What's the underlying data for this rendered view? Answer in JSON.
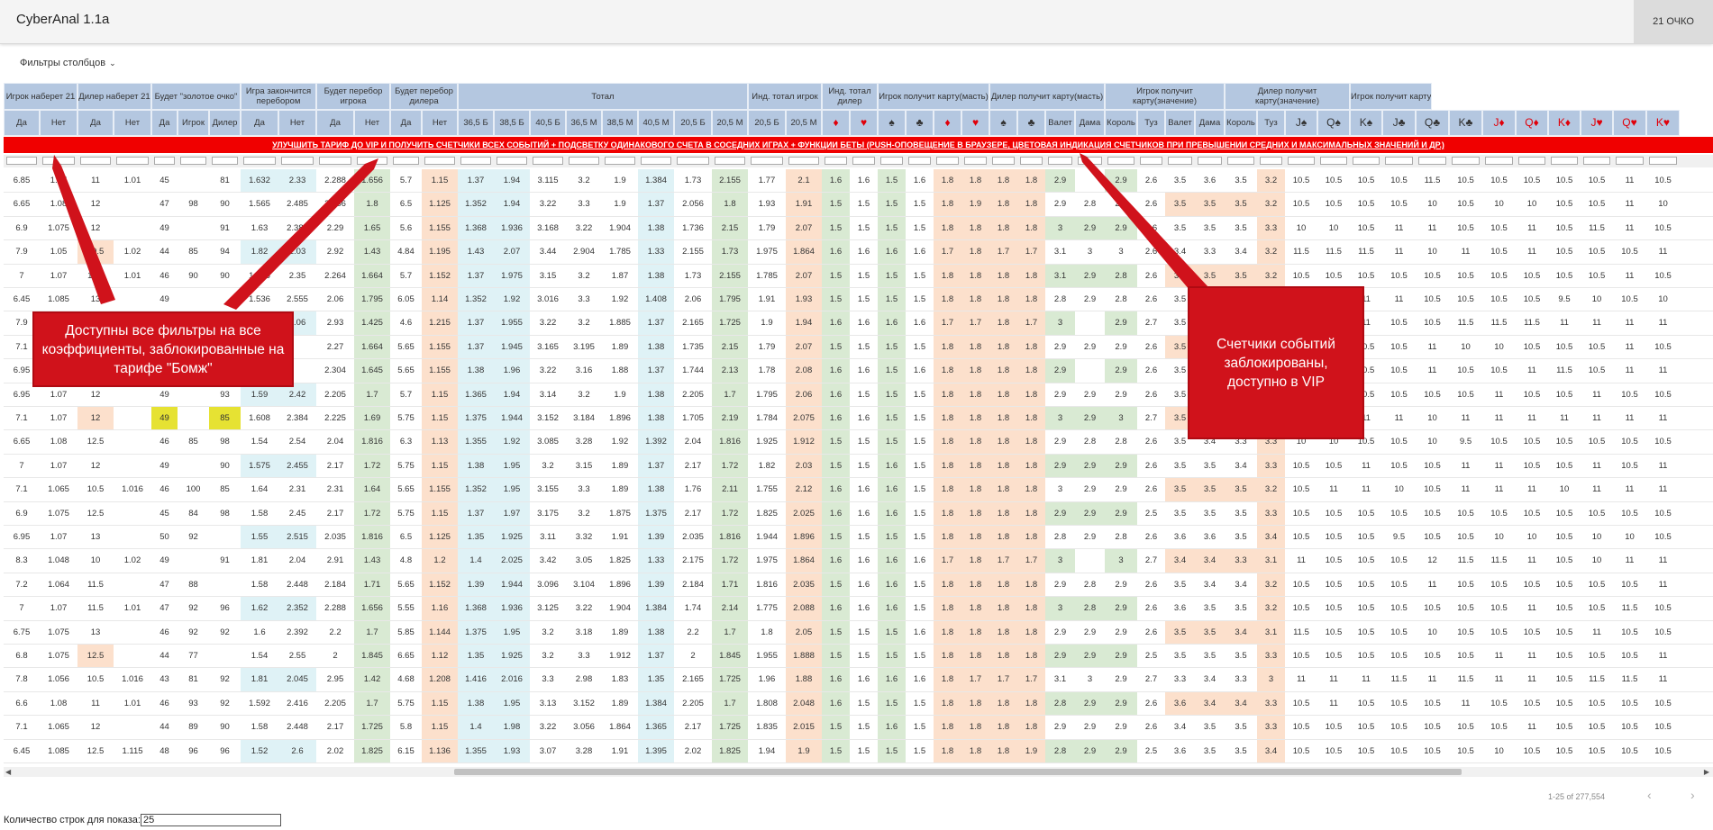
{
  "app": {
    "title": "CyberAnal 1.1a",
    "score": "21 ОЧКО"
  },
  "filters_label": "Фильтры столбцов",
  "header_groups": [
    {
      "label": "Игрок наберет 21",
      "cols": 2
    },
    {
      "label": "Дилер наберет 21",
      "cols": 2
    },
    {
      "label": "Будет \"золотое очко\"",
      "cols": 3
    },
    {
      "label": "Игра закончится перебором",
      "cols": 2
    },
    {
      "label": "Будет перебор игрока",
      "cols": 2
    },
    {
      "label": "Будет перебор дилера",
      "cols": 2
    },
    {
      "label": "Тотал",
      "cols": 8
    },
    {
      "label": "Инд. тотал игрок",
      "cols": 2
    },
    {
      "label": "Инд. тотал дилер",
      "cols": 2
    },
    {
      "label": "Игрок получит карту(масть)",
      "cols": 4
    },
    {
      "label": "Дилер получит карту(масть)",
      "cols": 4
    },
    {
      "label": "Игрок получит карту(значение)",
      "cols": 4
    },
    {
      "label": "Дилер получит карту(значение)",
      "cols": 4
    },
    {
      "label": "Игрок получит карту",
      "cols": 12
    }
  ],
  "sub_headers": [
    "Да",
    "Нет",
    "Да",
    "Нет",
    "Да",
    "Игрок",
    "Дилер",
    "Да",
    "Нет",
    "Да",
    "Нет",
    "Да",
    "Нет",
    "36,5 Б",
    "38,5 Б",
    "40,5 Б",
    "36,5 М",
    "38,5 М",
    "40,5 М",
    "20,5 Б",
    "20,5 М",
    "20,5 Б",
    "20,5 М",
    "♦",
    "♥",
    "♠",
    "♣",
    "♦",
    "♥",
    "♠",
    "♣",
    "Валет",
    "Дама",
    "Король",
    "Туз",
    "Валет",
    "Дама",
    "Король",
    "Туз",
    "J♠",
    "Q♠",
    "K♠",
    "J♣",
    "Q♣",
    "K♣",
    "J♦",
    "Q♦",
    "K♦",
    "J♥",
    "Q♥",
    "K♥"
  ],
  "banner": "УЛУЧШИТЬ ТАРИФ ДО VIP И ПОЛУЧИТЬ СЧЕТЧИКИ ВСЕХ СОБЫТИЙ + ПОДСВЕТКУ ОДИНАКОВОГО СЧЕТА В СОСЕДНИХ ИГРАХ + ФУНКЦИИ БЕТЫ (PUSH-ОПОВЕЩЕНИЕ В БРАУЗЕРЕ, ЦВЕТОВАЯ ИНДИКАЦИЯ СЧЕТЧИКОВ ПРИ ПРЕВЫШЕНИИ СРЕДНИХ И МАКСИМАЛЬНЫХ ЗНАЧЕНИЙ И ДР.)",
  "rows": [
    [
      "6.85",
      "1.07",
      "11",
      "1.01",
      "45",
      "",
      "81",
      "1.632",
      "2.33",
      "2.288",
      "1.656",
      "5.7",
      "1.15",
      "1.37",
      "1.94",
      "3.115",
      "3.2",
      "1.9",
      "1.384",
      "1.73",
      "2.155",
      "1.77",
      "2.1",
      "1.6",
      "1.6",
      "1.5",
      "1.6",
      "1.8",
      "1.8",
      "1.8",
      "1.8",
      "2.9",
      "",
      "2.9",
      "2.6",
      "3.5",
      "3.6",
      "3.5",
      "3.2",
      "10.5",
      "10.5",
      "10.5",
      "10.5",
      "11.5",
      "10.5",
      "10.5",
      "10.5",
      "10.5",
      "10.5",
      "11",
      "10.5"
    ],
    [
      "6.65",
      "1.08",
      "12",
      "",
      "47",
      "98",
      "90",
      "1.565",
      "2.485",
      "2.056",
      "1.8",
      "6.5",
      "1.125",
      "1.352",
      "1.94",
      "3.22",
      "3.3",
      "1.9",
      "1.37",
      "2.056",
      "1.8",
      "1.93",
      "1.91",
      "1.5",
      "1.5",
      "1.5",
      "1.5",
      "1.8",
      "1.9",
      "1.8",
      "1.8",
      "2.9",
      "2.8",
      "2.9",
      "2.6",
      "3.5",
      "3.5",
      "3.5",
      "3.2",
      "10.5",
      "10.5",
      "10.5",
      "10.5",
      "10",
      "10.5",
      "10",
      "10",
      "10.5",
      "10.5",
      "11",
      "10"
    ],
    [
      "6.9",
      "1.075",
      "12",
      "",
      "49",
      "",
      "91",
      "1.63",
      "2.385",
      "2.29",
      "1.65",
      "5.6",
      "1.155",
      "1.368",
      "1.936",
      "3.168",
      "3.22",
      "1.904",
      "1.38",
      "1.736",
      "2.15",
      "1.79",
      "2.07",
      "1.5",
      "1.5",
      "1.5",
      "1.5",
      "1.8",
      "1.8",
      "1.8",
      "1.8",
      "3",
      "2.9",
      "2.9",
      "2.6",
      "3.5",
      "3.5",
      "3.5",
      "3.3",
      "10",
      "10",
      "10.5",
      "11",
      "11",
      "10.5",
      "10.5",
      "11",
      "10.5",
      "11.5",
      "11",
      "10.5"
    ],
    [
      "7.9",
      "1.05",
      "10.5",
      "1.02",
      "44",
      "85",
      "94",
      "1.82",
      "2.03",
      "2.92",
      "1.43",
      "4.84",
      "1.195",
      "1.43",
      "2.07",
      "3.44",
      "2.904",
      "1.785",
      "1.33",
      "2.155",
      "1.73",
      "1.975",
      "1.864",
      "1.6",
      "1.6",
      "1.6",
      "1.6",
      "1.7",
      "1.8",
      "1.7",
      "1.7",
      "3.1",
      "3",
      "3",
      "2.6",
      "3.4",
      "3.3",
      "3.4",
      "3.2",
      "11.5",
      "11.5",
      "11.5",
      "11",
      "10",
      "11",
      "10.5",
      "11",
      "10.5",
      "10.5",
      "10.5",
      "11"
    ],
    [
      "7",
      "1.07",
      "11.5",
      "1.01",
      "46",
      "90",
      "90",
      "1.625",
      "2.35",
      "2.264",
      "1.664",
      "5.7",
      "1.152",
      "1.37",
      "1.975",
      "3.15",
      "3.2",
      "1.87",
      "1.38",
      "1.73",
      "2.155",
      "1.785",
      "2.07",
      "1.5",
      "1.5",
      "1.5",
      "1.5",
      "1.8",
      "1.8",
      "1.8",
      "1.8",
      "3.1",
      "2.9",
      "2.8",
      "2.6",
      "3.5",
      "3.5",
      "3.5",
      "3.2",
      "10.5",
      "10.5",
      "10.5",
      "10.5",
      "10.5",
      "10.5",
      "10.5",
      "10.5",
      "10.5",
      "10.5",
      "11",
      "10.5"
    ],
    [
      "6.45",
      "1.085",
      "13",
      "",
      "49",
      "",
      "",
      "1.536",
      "2.555",
      "2.06",
      "1.795",
      "6.05",
      "1.14",
      "1.352",
      "1.92",
      "3.016",
      "3.3",
      "1.92",
      "1.408",
      "2.06",
      "1.795",
      "1.91",
      "1.93",
      "1.5",
      "1.5",
      "1.5",
      "1.5",
      "1.8",
      "1.8",
      "1.8",
      "1.8",
      "2.8",
      "2.9",
      "2.8",
      "2.6",
      "3.5",
      "3.5",
      "3.5",
      "3.3",
      "10.5",
      "10.5",
      "11",
      "11",
      "10.5",
      "10.5",
      "10.5",
      "10.5",
      "9.5",
      "10",
      "10.5",
      "10"
    ],
    [
      "7.9",
      "1.05",
      "",
      "",
      "",
      "",
      "",
      "1.8",
      "2.06",
      "2.93",
      "1.425",
      "4.6",
      "1.215",
      "1.37",
      "1.955",
      "3.22",
      "3.2",
      "1.885",
      "1.37",
      "2.165",
      "1.725",
      "1.9",
      "1.94",
      "1.6",
      "1.6",
      "1.6",
      "1.6",
      "1.7",
      "1.7",
      "1.8",
      "1.7",
      "3",
      "",
      "2.9",
      "2.7",
      "3.5",
      "3.5",
      "3.5",
      "3.2",
      "10.5",
      "10.5",
      "11",
      "10.5",
      "10.5",
      "11.5",
      "11.5",
      "11.5",
      "11",
      "11",
      "11",
      "11"
    ],
    [
      "7.1",
      "",
      "",
      "",
      "",
      "",
      "",
      "",
      "",
      "2.27",
      "1.664",
      "5.65",
      "1.155",
      "1.37",
      "1.945",
      "3.165",
      "3.195",
      "1.89",
      "1.38",
      "1.735",
      "2.15",
      "1.79",
      "2.07",
      "1.5",
      "1.5",
      "1.5",
      "1.5",
      "1.8",
      "1.8",
      "1.8",
      "1.8",
      "2.9",
      "2.9",
      "2.9",
      "2.6",
      "3.5",
      "3.5",
      "3.5",
      "3.3",
      "10.5",
      "10.5",
      "10.5",
      "10.5",
      "11",
      "10",
      "10",
      "10.5",
      "10.5",
      "10.5",
      "11",
      "10.5"
    ],
    [
      "6.95",
      "",
      "",
      "",
      "",
      "",
      "",
      "",
      "",
      "2.304",
      "1.645",
      "5.65",
      "1.155",
      "1.38",
      "1.96",
      "3.22",
      "3.16",
      "1.88",
      "1.37",
      "1.744",
      "2.13",
      "1.78",
      "2.08",
      "1.6",
      "1.6",
      "1.5",
      "1.6",
      "1.8",
      "1.8",
      "1.8",
      "1.8",
      "2.9",
      "",
      "2.9",
      "2.6",
      "3.5",
      "3.5",
      "3.5",
      "3.3",
      "11",
      "10.5",
      "10.5",
      "10.5",
      "11",
      "10.5",
      "10.5",
      "11",
      "11.5",
      "10.5",
      "11",
      "11"
    ],
    [
      "6.95",
      "1.07",
      "12",
      "",
      "49",
      "",
      "93",
      "1.59",
      "2.42",
      "2.205",
      "1.7",
      "5.7",
      "1.15",
      "1.365",
      "1.94",
      "3.14",
      "3.2",
      "1.9",
      "1.38",
      "2.205",
      "1.7",
      "1.795",
      "2.06",
      "1.6",
      "1.5",
      "1.5",
      "1.5",
      "1.8",
      "1.8",
      "1.8",
      "1.8",
      "2.9",
      "2.9",
      "2.9",
      "2.6",
      "3.5",
      "3.5",
      "3.5",
      "3.3",
      "10.5",
      "11",
      "10.5",
      "10.5",
      "10.5",
      "10.5",
      "11",
      "10.5",
      "10.5",
      "11",
      "10.5",
      "10.5"
    ],
    [
      "7.1",
      "1.07",
      "12",
      "",
      "49",
      "",
      "85",
      "1.608",
      "2.384",
      "2.225",
      "1.69",
      "5.75",
      "1.15",
      "1.375",
      "1.944",
      "3.152",
      "3.184",
      "1.896",
      "1.38",
      "1.705",
      "2.19",
      "1.784",
      "2.075",
      "1.6",
      "1.6",
      "1.5",
      "1.5",
      "1.8",
      "1.8",
      "1.8",
      "1.8",
      "3",
      "2.9",
      "3",
      "2.7",
      "3.5",
      "3.5",
      "3.4",
      "3.3",
      "11",
      "11",
      "11",
      "11",
      "10",
      "11",
      "11",
      "11",
      "11",
      "11",
      "11",
      "11"
    ],
    [
      "6.65",
      "1.08",
      "12.5",
      "",
      "46",
      "85",
      "98",
      "1.54",
      "2.54",
      "2.04",
      "1.816",
      "6.3",
      "1.13",
      "1.355",
      "1.92",
      "3.085",
      "3.28",
      "1.92",
      "1.392",
      "2.04",
      "1.816",
      "1.925",
      "1.912",
      "1.5",
      "1.5",
      "1.5",
      "1.5",
      "1.8",
      "1.8",
      "1.8",
      "1.8",
      "2.9",
      "2.8",
      "2.8",
      "2.6",
      "3.5",
      "3.4",
      "3.3",
      "3.3",
      "10",
      "10",
      "10.5",
      "10.5",
      "10",
      "9.5",
      "10.5",
      "10.5",
      "10.5",
      "10.5",
      "10.5",
      "10.5"
    ],
    [
      "7",
      "1.07",
      "12",
      "",
      "49",
      "",
      "90",
      "1.575",
      "2.455",
      "2.17",
      "1.72",
      "5.75",
      "1.15",
      "1.38",
      "1.95",
      "3.2",
      "3.15",
      "1.89",
      "1.37",
      "2.17",
      "1.72",
      "1.82",
      "2.03",
      "1.5",
      "1.5",
      "1.6",
      "1.5",
      "1.8",
      "1.8",
      "1.8",
      "1.8",
      "2.9",
      "2.9",
      "2.9",
      "2.6",
      "3.5",
      "3.5",
      "3.4",
      "3.3",
      "10.5",
      "10.5",
      "11",
      "10.5",
      "10.5",
      "11",
      "11",
      "10.5",
      "10.5",
      "11",
      "10.5",
      "11"
    ],
    [
      "7.1",
      "1.065",
      "10.5",
      "1.016",
      "46",
      "100",
      "85",
      "1.64",
      "2.31",
      "2.31",
      "1.64",
      "5.65",
      "1.155",
      "1.352",
      "1.95",
      "3.155",
      "3.3",
      "1.89",
      "1.38",
      "1.76",
      "2.11",
      "1.755",
      "2.12",
      "1.6",
      "1.6",
      "1.6",
      "1.5",
      "1.8",
      "1.8",
      "1.8",
      "1.8",
      "3",
      "2.9",
      "2.9",
      "2.6",
      "3.5",
      "3.5",
      "3.5",
      "3.2",
      "10.5",
      "11",
      "11",
      "10",
      "10.5",
      "11",
      "11",
      "11",
      "10",
      "11",
      "11",
      "11"
    ],
    [
      "6.9",
      "1.075",
      "12.5",
      "",
      "45",
      "84",
      "98",
      "1.58",
      "2.45",
      "2.17",
      "1.72",
      "5.75",
      "1.15",
      "1.37",
      "1.97",
      "3.175",
      "3.2",
      "1.875",
      "1.375",
      "2.17",
      "1.72",
      "1.825",
      "2.025",
      "1.6",
      "1.6",
      "1.6",
      "1.5",
      "1.8",
      "1.8",
      "1.8",
      "1.8",
      "2.9",
      "2.9",
      "2.9",
      "2.5",
      "3.5",
      "3.5",
      "3.5",
      "3.3",
      "10.5",
      "10.5",
      "10.5",
      "10.5",
      "10.5",
      "10.5",
      "10.5",
      "10.5",
      "10.5",
      "10.5",
      "10.5",
      "10.5"
    ],
    [
      "6.95",
      "1.07",
      "13",
      "",
      "50",
      "92",
      "",
      "1.55",
      "2.515",
      "2.035",
      "1.816",
      "6.5",
      "1.125",
      "1.35",
      "1.925",
      "3.11",
      "3.32",
      "1.91",
      "1.39",
      "2.035",
      "1.816",
      "1.944",
      "1.896",
      "1.5",
      "1.5",
      "1.5",
      "1.5",
      "1.8",
      "1.8",
      "1.8",
      "1.8",
      "2.8",
      "2.9",
      "2.8",
      "2.6",
      "3.6",
      "3.6",
      "3.5",
      "3.4",
      "10.5",
      "10.5",
      "10.5",
      "9.5",
      "10.5",
      "10.5",
      "10",
      "10",
      "10.5",
      "10",
      "10",
      "10.5"
    ],
    [
      "8.3",
      "1.048",
      "10",
      "1.02",
      "49",
      "",
      "91",
      "1.81",
      "2.04",
      "2.91",
      "1.43",
      "4.8",
      "1.2",
      "1.4",
      "2.025",
      "3.42",
      "3.05",
      "1.825",
      "1.33",
      "2.175",
      "1.72",
      "1.975",
      "1.864",
      "1.6",
      "1.6",
      "1.6",
      "1.6",
      "1.7",
      "1.8",
      "1.7",
      "1.7",
      "3",
      "",
      "3",
      "2.7",
      "3.4",
      "3.4",
      "3.3",
      "3.1",
      "11",
      "10.5",
      "10.5",
      "10.5",
      "12",
      "11.5",
      "11.5",
      "11",
      "10.5",
      "10",
      "11",
      "11"
    ],
    [
      "7.2",
      "1.064",
      "11.5",
      "",
      "47",
      "88",
      "",
      "1.58",
      "2.448",
      "2.184",
      "1.71",
      "5.65",
      "1.152",
      "1.39",
      "1.944",
      "3.096",
      "3.104",
      "1.896",
      "1.39",
      "2.184",
      "1.71",
      "1.816",
      "2.035",
      "1.5",
      "1.6",
      "1.6",
      "1.5",
      "1.8",
      "1.8",
      "1.8",
      "1.8",
      "2.9",
      "2.8",
      "2.9",
      "2.6",
      "3.5",
      "3.4",
      "3.4",
      "3.2",
      "10.5",
      "10.5",
      "10.5",
      "10.5",
      "11",
      "10.5",
      "10.5",
      "10.5",
      "10.5",
      "10.5",
      "10.5",
      "11"
    ],
    [
      "7",
      "1.07",
      "11.5",
      "1.01",
      "47",
      "92",
      "96",
      "1.62",
      "2.352",
      "2.288",
      "1.656",
      "5.55",
      "1.16",
      "1.368",
      "1.936",
      "3.125",
      "3.22",
      "1.904",
      "1.384",
      "1.74",
      "2.14",
      "1.775",
      "2.088",
      "1.6",
      "1.6",
      "1.6",
      "1.5",
      "1.8",
      "1.8",
      "1.8",
      "1.8",
      "3",
      "2.8",
      "2.9",
      "2.6",
      "3.6",
      "3.5",
      "3.5",
      "3.2",
      "10.5",
      "10.5",
      "10.5",
      "10.5",
      "10.5",
      "10.5",
      "10.5",
      "11",
      "10.5",
      "10.5",
      "11.5",
      "10.5"
    ],
    [
      "6.75",
      "1.075",
      "13",
      "",
      "46",
      "92",
      "92",
      "1.6",
      "2.392",
      "2.2",
      "1.7",
      "5.85",
      "1.144",
      "1.375",
      "1.95",
      "3.2",
      "3.18",
      "1.89",
      "1.38",
      "2.2",
      "1.7",
      "1.8",
      "2.05",
      "1.5",
      "1.5",
      "1.5",
      "1.6",
      "1.8",
      "1.8",
      "1.8",
      "1.8",
      "2.9",
      "2.9",
      "2.9",
      "2.6",
      "3.5",
      "3.5",
      "3.4",
      "3.1",
      "11.5",
      "10.5",
      "10.5",
      "10.5",
      "10",
      "10.5",
      "10.5",
      "10.5",
      "10.5",
      "11",
      "10.5",
      "10.5"
    ],
    [
      "6.8",
      "1.075",
      "12.5",
      "",
      "44",
      "77",
      "",
      "1.54",
      "2.55",
      "2",
      "1.845",
      "6.65",
      "1.12",
      "1.35",
      "1.925",
      "3.2",
      "3.3",
      "1.912",
      "1.37",
      "2",
      "1.845",
      "1.955",
      "1.888",
      "1.5",
      "1.5",
      "1.5",
      "1.5",
      "1.8",
      "1.8",
      "1.8",
      "1.8",
      "2.9",
      "2.9",
      "2.9",
      "2.5",
      "3.5",
      "3.5",
      "3.5",
      "3.3",
      "10.5",
      "10.5",
      "10.5",
      "10.5",
      "10.5",
      "10.5",
      "11",
      "11",
      "10.5",
      "10.5",
      "10.5",
      "11"
    ],
    [
      "7.8",
      "1.056",
      "10.5",
      "1.016",
      "43",
      "81",
      "92",
      "1.81",
      "2.045",
      "2.95",
      "1.42",
      "4.68",
      "1.208",
      "1.416",
      "2.016",
      "3.3",
      "2.98",
      "1.83",
      "1.35",
      "2.165",
      "1.725",
      "1.96",
      "1.88",
      "1.6",
      "1.6",
      "1.6",
      "1.6",
      "1.8",
      "1.7",
      "1.7",
      "1.7",
      "3.1",
      "3",
      "2.9",
      "2.7",
      "3.3",
      "3.4",
      "3.3",
      "3",
      "11",
      "11",
      "11",
      "11.5",
      "11",
      "11.5",
      "11",
      "11",
      "10.5",
      "11.5",
      "11.5",
      "11"
    ],
    [
      "6.6",
      "1.08",
      "11",
      "1.01",
      "46",
      "93",
      "92",
      "1.592",
      "2.416",
      "2.205",
      "1.7",
      "5.75",
      "1.15",
      "1.38",
      "1.95",
      "3.13",
      "3.152",
      "1.89",
      "1.384",
      "2.205",
      "1.7",
      "1.808",
      "2.048",
      "1.6",
      "1.5",
      "1.5",
      "1.5",
      "1.8",
      "1.8",
      "1.8",
      "1.8",
      "2.8",
      "2.9",
      "2.9",
      "2.6",
      "3.6",
      "3.4",
      "3.4",
      "3.3",
      "10.5",
      "11",
      "10.5",
      "10.5",
      "10.5",
      "11",
      "10.5",
      "10.5",
      "10.5",
      "10.5",
      "10.5",
      "10.5"
    ],
    [
      "7.1",
      "1.065",
      "12",
      "",
      "44",
      "89",
      "90",
      "1.58",
      "2.448",
      "2.17",
      "1.725",
      "5.8",
      "1.15",
      "1.4",
      "1.98",
      "3.22",
      "3.056",
      "1.864",
      "1.365",
      "2.17",
      "1.725",
      "1.835",
      "2.015",
      "1.5",
      "1.5",
      "1.6",
      "1.5",
      "1.8",
      "1.8",
      "1.8",
      "1.8",
      "2.9",
      "2.9",
      "2.9",
      "2.6",
      "3.4",
      "3.5",
      "3.5",
      "3.3",
      "10.5",
      "10.5",
      "10.5",
      "10.5",
      "10.5",
      "10.5",
      "10.5",
      "11",
      "10.5",
      "10.5",
      "10.5",
      "10.5"
    ],
    [
      "6.45",
      "1.085",
      "12.5",
      "1.115",
      "48",
      "96",
      "96",
      "1.52",
      "2.6",
      "2.02",
      "1.825",
      "6.15",
      "1.136",
      "1.355",
      "1.93",
      "3.07",
      "3.28",
      "1.91",
      "1.395",
      "2.02",
      "1.825",
      "1.94",
      "1.9",
      "1.5",
      "1.5",
      "1.5",
      "1.5",
      "1.8",
      "1.8",
      "1.8",
      "1.9",
      "2.8",
      "2.9",
      "2.9",
      "2.5",
      "3.6",
      "3.5",
      "3.5",
      "3.4",
      "10.5",
      "10.5",
      "10.5",
      "10.5",
      "10.5",
      "10.5",
      "10",
      "10.5",
      "10.5",
      "10.5",
      "10.5",
      "10.5"
    ]
  ],
  "pagination": {
    "range": "1-25 of 277,554",
    "prev": "‹",
    "next": "›"
  },
  "rows_label": "Количество строк для показа:",
  "rows_value": "25",
  "callout_left": "Доступны все фильтры на все коэффициенты, заблокированные на тарифе \"Бомж\"",
  "callout_right": "Счетчики событий заблокированы, доступно в VIP",
  "colors": {
    "header": "#b4c7e0",
    "banner": "#f00000",
    "callout": "#d0121b",
    "highlight_green": "#d9ead3",
    "highlight_orange": "#fce0cc",
    "highlight_cyan": "#dff2f6",
    "highlight_yellow": "#e6e233"
  }
}
